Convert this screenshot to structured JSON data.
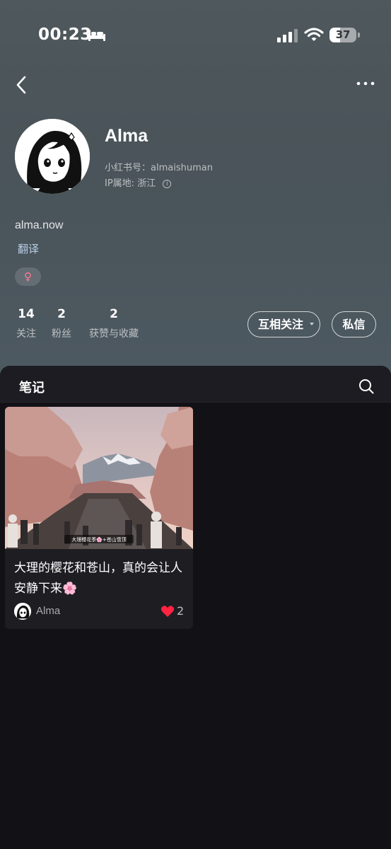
{
  "status_bar": {
    "time": "00:23",
    "battery_level": "37",
    "icons": [
      "bed-icon",
      "signal-icon",
      "wifi-icon",
      "battery-icon"
    ]
  },
  "nav": {
    "back_icon": "chevron-left-icon",
    "more_icon": "more-dots-icon"
  },
  "profile": {
    "username": "Alma",
    "red_id_label": "小红书号：",
    "red_id": "almaishuman",
    "ip_label": "IP属地: ",
    "ip_location": "浙江",
    "bio": "alma.now",
    "translate_label": "翻译",
    "gender_symbol": "♀",
    "gender_color": "#ff7a92"
  },
  "stats": [
    {
      "value": "14",
      "label": "关注"
    },
    {
      "value": "2",
      "label": "粉丝"
    },
    {
      "value": "2",
      "label": "获赞与收藏"
    }
  ],
  "actions": {
    "follow_label": "互相关注",
    "message_label": "私信"
  },
  "notes_section": {
    "title": "笔记",
    "search_icon": "search-icon"
  },
  "notes": [
    {
      "title": "大理的樱花和苍山，真的会让人安静下来🌸",
      "image_caption": "大理樱花季🌸+苍山雪顶",
      "author": "Alma",
      "likes": "2",
      "like_color": "#ff2442"
    }
  ]
}
